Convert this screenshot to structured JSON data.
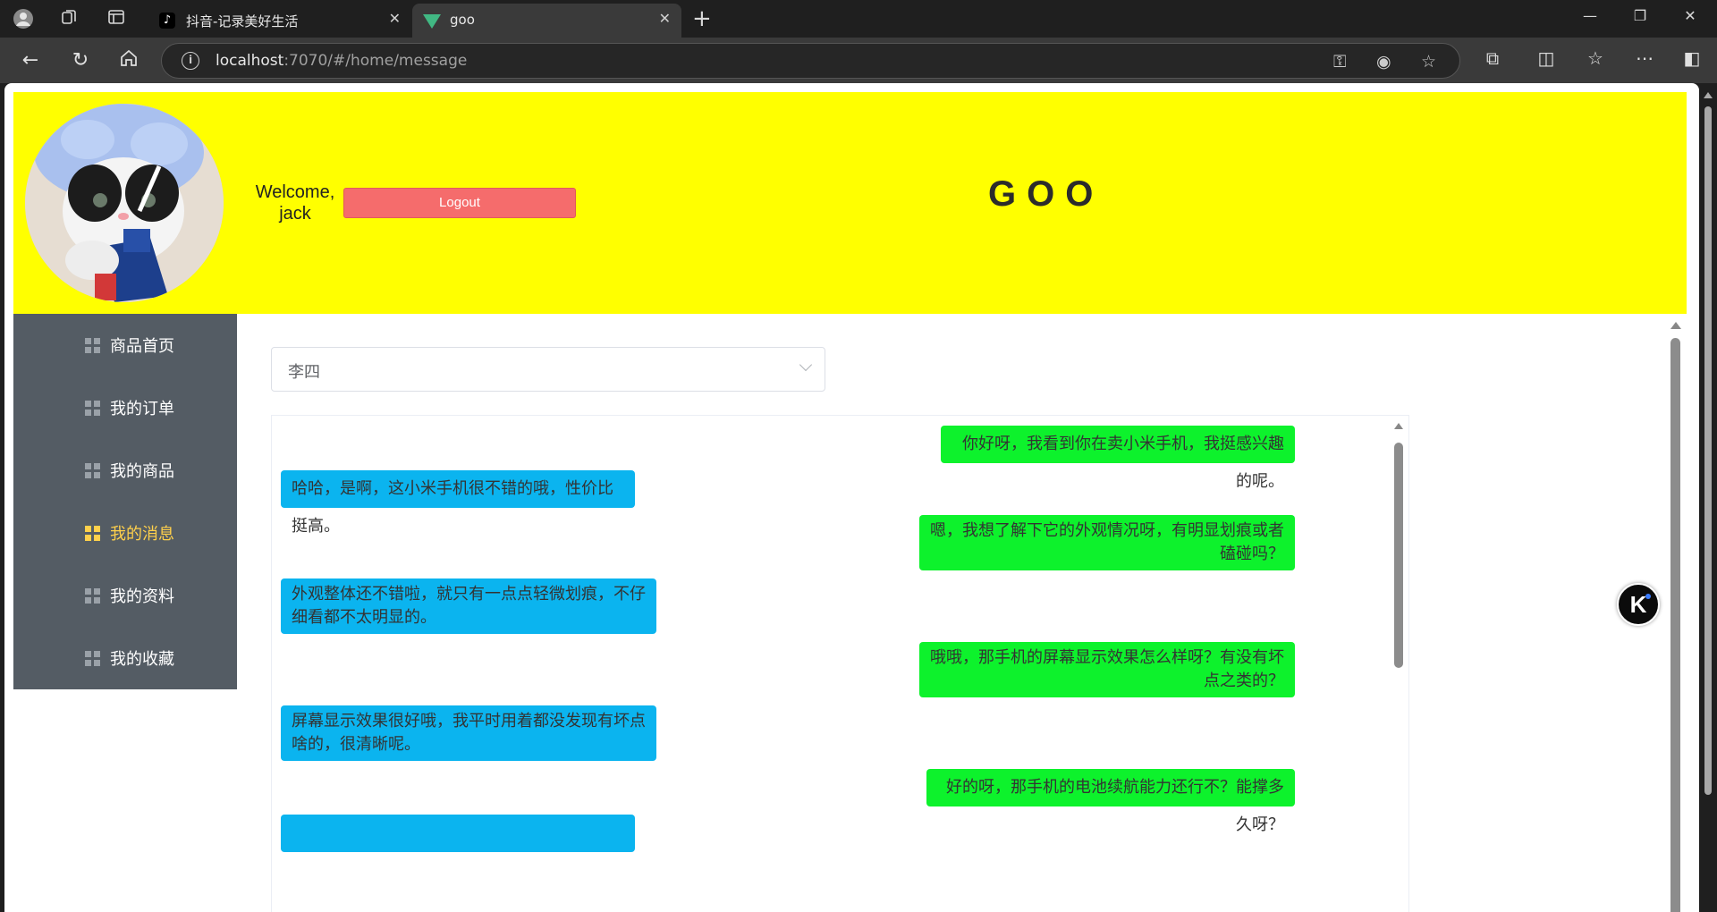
{
  "browser": {
    "tabs": [
      {
        "title": "抖音-记录美好生活",
        "icon": "tiktok-icon",
        "active": false
      },
      {
        "title": "goo",
        "icon": "vue-icon",
        "active": true
      }
    ],
    "url_host": "localhost",
    "url_path": ":7070/#/home/message"
  },
  "header": {
    "welcome_line1": "Welcome,",
    "welcome_line2": "jack",
    "logout_label": "Logout",
    "brand": "GOO",
    "header_color": "#ffff00",
    "logout_color": "#f56c6c"
  },
  "sidebar": {
    "bg_color": "#545c64",
    "active_color": "#ffd04b",
    "items": [
      {
        "label": "商品首页",
        "icon": "grid-icon",
        "active": false
      },
      {
        "label": "我的订单",
        "icon": "grid-icon",
        "active": false
      },
      {
        "label": "我的商品",
        "icon": "grid-icon",
        "active": false
      },
      {
        "label": "我的消息",
        "icon": "grid-icon",
        "active": true
      },
      {
        "label": "我的资料",
        "icon": "grid-icon",
        "active": false
      },
      {
        "label": "我的收藏",
        "icon": "grid-icon",
        "active": false
      }
    ]
  },
  "chat": {
    "selected_contact": "李四",
    "sent_color": "#0df22c",
    "received_color": "#0bb4ef",
    "messages": [
      {
        "direction": "sent",
        "text": "你好呀，我看到你在卖小米手机，我挺感兴趣的呢。"
      },
      {
        "direction": "received",
        "text": "哈哈，是啊，这小米手机很不错的哦，性价比挺高。"
      },
      {
        "direction": "sent",
        "text": "嗯，我想了解下它的外观情况呀，有明显划痕或者磕碰吗？"
      },
      {
        "direction": "received",
        "text": "外观整体还不错啦，就只有一点点轻微划痕，不仔细看都不太明显的。"
      },
      {
        "direction": "sent",
        "text": "哦哦，那手机的屏幕显示效果怎么样呀？有没有坏点之类的？"
      },
      {
        "direction": "received",
        "text": "屏幕显示效果很好哦，我平时用着都没发现有坏点啥的，很清晰呢。"
      },
      {
        "direction": "sent",
        "text": "好的呀，那手机的电池续航能力还行不？能撑多久呀？"
      }
    ]
  },
  "floating_button": {
    "label": "K",
    "icon": "k-assistant-icon"
  }
}
